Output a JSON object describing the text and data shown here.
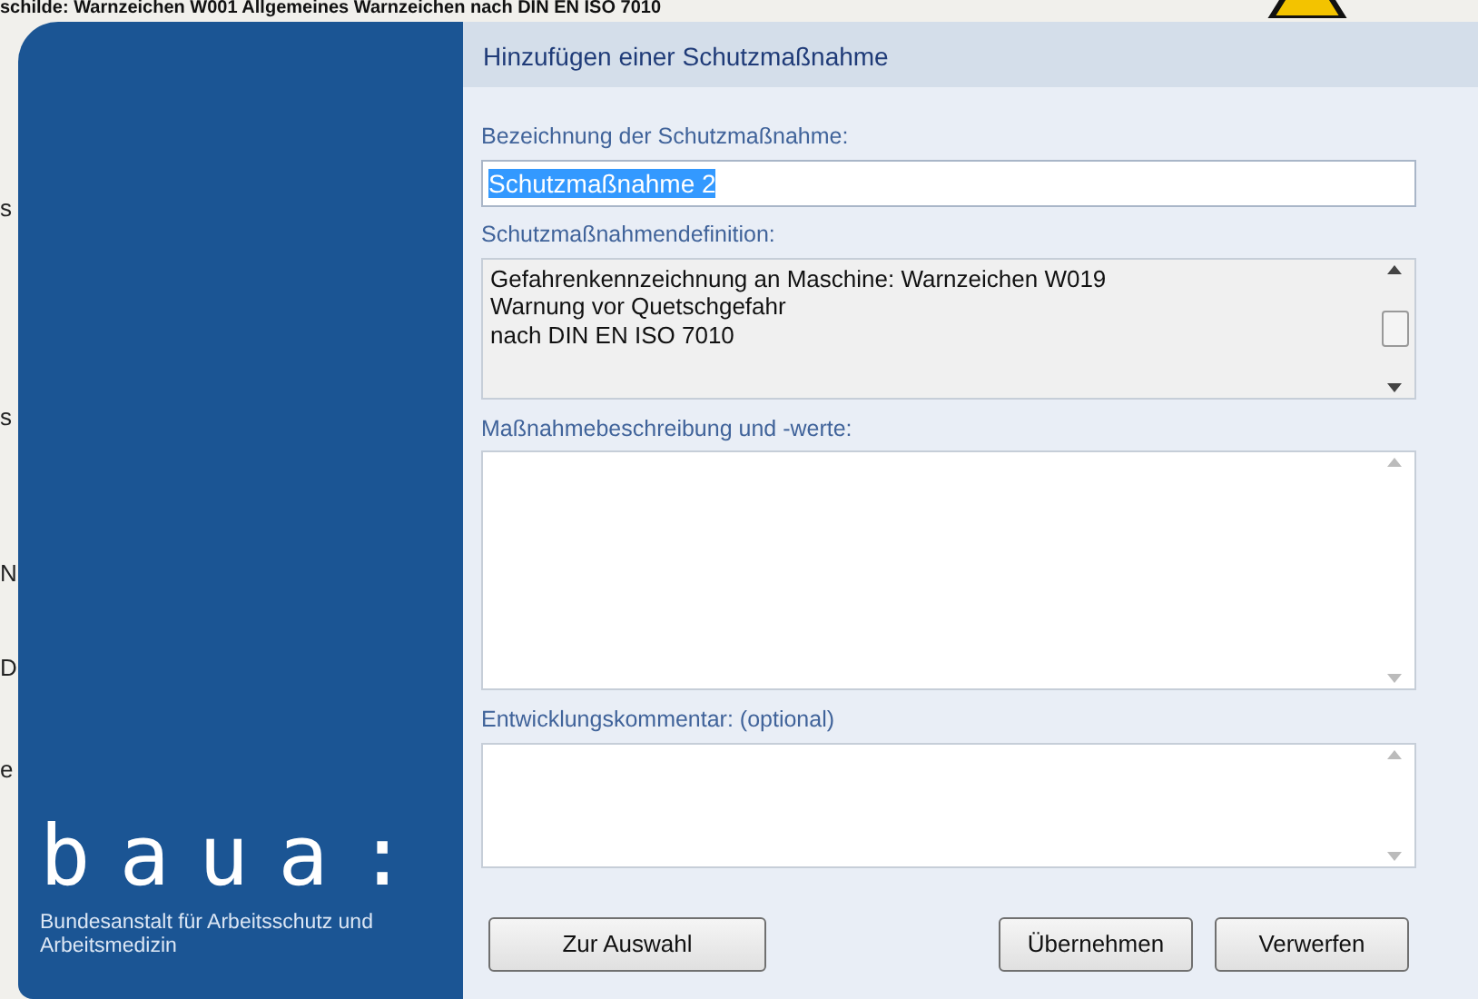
{
  "background": {
    "heading": "schilde: Warnzeichen W001 Allgemeines Warnzeichen nach DIN EN ISO 7010",
    "fragments": [
      "s",
      "s",
      "N",
      "D",
      "e"
    ]
  },
  "sidebar": {
    "logo_text": "baua:",
    "logo_subtitle": "Bundesanstalt für Arbeitsschutz und Arbeitsmedizin"
  },
  "dialog": {
    "title": "Hinzufügen einer Schutzmaßnahme",
    "fields": [
      {
        "kind": "input",
        "label": "Bezeichnung der Schutzmaßnahme:",
        "value": "Schutzmaßnahme 2",
        "text_selected": true
      },
      {
        "kind": "readonly",
        "label": "Schutzmaßnahmendefinition:",
        "lines": [
          "Gefahrenkennzeichnung an Maschine: Warnzeichen W019",
          "Warnung vor Quetschgefahr",
          "nach DIN EN ISO 7010"
        ]
      },
      {
        "kind": "textarea",
        "label": "Maßnahmebeschreibung und -werte:"
      },
      {
        "kind": "textarea",
        "label": "Entwicklungskommentar: (optional)"
      }
    ],
    "buttons": [
      {
        "label": "Zur Auswahl"
      },
      {
        "label": "Übernehmen"
      },
      {
        "label": "Verwerfen"
      }
    ]
  }
}
